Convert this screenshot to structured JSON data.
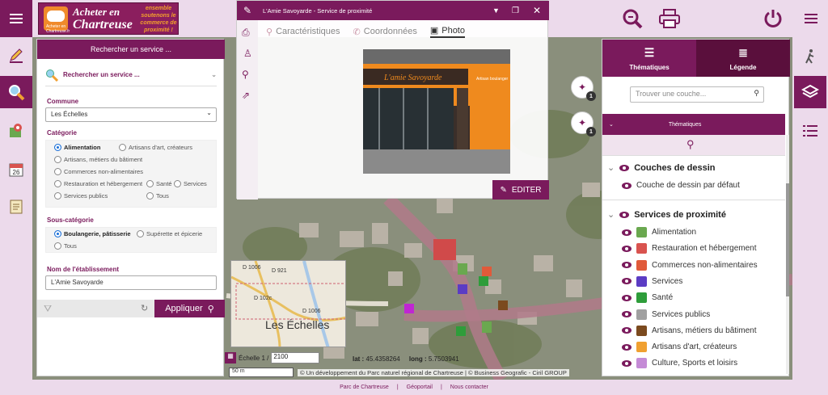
{
  "header": {
    "logo_line1": "Acheter en",
    "logo_line2": "Chartreuse",
    "logo_small": "Acheter en Chartreuse.fr",
    "logo_tagline": "ensemble soutenons le commerce de proximité !"
  },
  "left_panel": {
    "title": "Rechercher un service ...",
    "search_label": "Rechercher un service ...",
    "commune_label": "Commune",
    "commune_value": "Les Échelles",
    "categorie_label": "Catégorie",
    "categories": [
      {
        "label": "Alimentation",
        "selected": true
      },
      {
        "label": "Artisans d'art, créateurs",
        "selected": false
      },
      {
        "label": "Artisans, métiers du bâtiment",
        "selected": false
      },
      {
        "label": "Commerces non-alimentaires",
        "selected": false
      },
      {
        "label": "Restauration et hébergement",
        "selected": false
      },
      {
        "label": "Santé",
        "selected": false
      },
      {
        "label": "Services",
        "selected": false
      },
      {
        "label": "Services publics",
        "selected": false
      },
      {
        "label": "Tous",
        "selected": false
      }
    ],
    "souscat_label": "Sous-catégorie",
    "souscats": [
      {
        "label": "Boulangerie, pâtisserie",
        "selected": true
      },
      {
        "label": "Supérette et épicerie",
        "selected": false
      },
      {
        "label": "Tous",
        "selected": false
      }
    ],
    "name_label": "Nom de l'établissement",
    "name_value": "L'Amie Savoyarde",
    "apply_label": "Appliquer"
  },
  "popup": {
    "title": "L'Amie Savoyarde - Service de proximité",
    "tabs": [
      "Caractéristiques",
      "Coordonnées",
      "Photo"
    ],
    "active_tab": "Photo",
    "edit_label": "EDITER",
    "shop_sign": "L'amie Savoyarde",
    "shop_sign_right": "Artisan boulanger"
  },
  "right_panel": {
    "tab_thematiques": "Thématiques",
    "tab_legende": "Légende",
    "filter_placeholder": "Trouver une couche...",
    "thematiques_bar": "Thématiques",
    "group1": "Couches de dessin",
    "group1_items": [
      "Couche de dessin par défaut"
    ],
    "group2": "Services de proximité",
    "group2_items": [
      {
        "label": "Alimentation",
        "color": "#6aa84f"
      },
      {
        "label": "Restauration et hébergement",
        "color": "#d9534f"
      },
      {
        "label": "Commerces non-alimentaires",
        "color": "#e05a3a"
      },
      {
        "label": "Services",
        "color": "#5b3cc4"
      },
      {
        "label": "Santé",
        "color": "#2e9d3a"
      },
      {
        "label": "Services publics",
        "color": "#a0a0a0"
      },
      {
        "label": "Artisans, métiers du bâtiment",
        "color": "#7b4a1e"
      },
      {
        "label": "Artisans d'art, créateurs",
        "color": "#f0a030"
      },
      {
        "label": "Culture, Sports et loisirs",
        "color": "#c58bd6"
      }
    ]
  },
  "map": {
    "scale_label": "Échelle 1 /",
    "scale_value": "2100",
    "lat_label": "lat :",
    "lat_value": "45.4358264",
    "long_label": "long :",
    "long_value": "5.7503941",
    "scalebar": "50 m",
    "credits": "© Un développement du Parc naturel régional de Chartreuse | © Business Geografic - Ciril GROUP",
    "badge1_count": "1",
    "badge2_count": "1",
    "minimap_town": "Les Échelles",
    "minimap_roads": [
      "D 1006",
      "D 921",
      "D 102c",
      "D 1006",
      "D 1006"
    ]
  },
  "footer": {
    "links": [
      "Parc de Chartreuse",
      "Géoportail",
      "Nous contacter"
    ],
    "sep": "|"
  }
}
